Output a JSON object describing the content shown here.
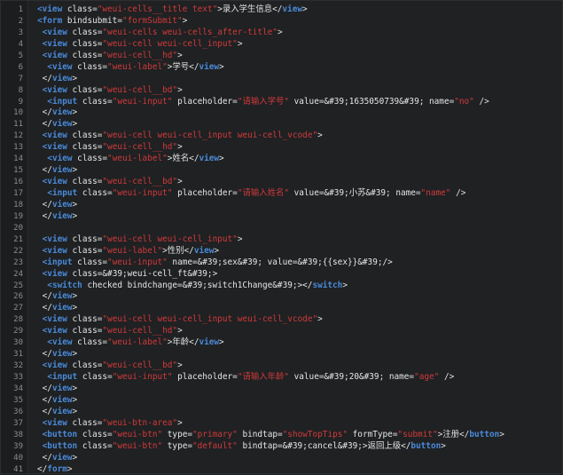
{
  "editor": {
    "lines": [
      {
        "n": "1",
        "t": [
          [
            "tag",
            "<view"
          ],
          [
            "attr",
            " class="
          ],
          [
            "str",
            "\"weui-cells__title text\""
          ],
          [
            "plain",
            ">录入学生信息</"
          ],
          [
            "tag",
            "view"
          ],
          [
            "plain",
            ">"
          ]
        ]
      },
      {
        "n": "2",
        "t": [
          [
            "tag",
            "<form"
          ],
          [
            "attr",
            " bindsubmit="
          ],
          [
            "str",
            "\"formSubmit\""
          ],
          [
            "plain",
            ">"
          ]
        ]
      },
      {
        "n": "3",
        "t": [
          [
            "plain",
            " "
          ],
          [
            "tag",
            "<view"
          ],
          [
            "attr",
            " class="
          ],
          [
            "str",
            "\"weui-cells weui-cells_after-title\""
          ],
          [
            "plain",
            ">"
          ]
        ]
      },
      {
        "n": "4",
        "t": [
          [
            "plain",
            " "
          ],
          [
            "tag",
            "<view"
          ],
          [
            "attr",
            " class="
          ],
          [
            "str",
            "\"weui-cell weui-cell_input\""
          ],
          [
            "plain",
            ">"
          ]
        ]
      },
      {
        "n": "5",
        "t": [
          [
            "plain",
            " "
          ],
          [
            "tag",
            "<view"
          ],
          [
            "attr",
            " class="
          ],
          [
            "str",
            "\"weui-cell__hd\""
          ],
          [
            "plain",
            ">"
          ]
        ]
      },
      {
        "n": "6",
        "t": [
          [
            "plain",
            "  "
          ],
          [
            "tag",
            "<view"
          ],
          [
            "attr",
            " class="
          ],
          [
            "str",
            "\"weui-label\""
          ],
          [
            "plain",
            ">学号</"
          ],
          [
            "tag",
            "view"
          ],
          [
            "plain",
            ">"
          ]
        ]
      },
      {
        "n": "7",
        "t": [
          [
            "plain",
            " </"
          ],
          [
            "tag",
            "view"
          ],
          [
            "plain",
            ">"
          ]
        ]
      },
      {
        "n": "8",
        "t": [
          [
            "plain",
            " "
          ],
          [
            "tag",
            "<view"
          ],
          [
            "attr",
            " class="
          ],
          [
            "str",
            "\"weui-cell__bd\""
          ],
          [
            "plain",
            ">"
          ]
        ]
      },
      {
        "n": "9",
        "t": [
          [
            "plain",
            "  "
          ],
          [
            "tag",
            "<input"
          ],
          [
            "attr",
            " class="
          ],
          [
            "str",
            "\"weui-input\""
          ],
          [
            "attr",
            " placeholder="
          ],
          [
            "str",
            "\"请输入学号\""
          ],
          [
            "attr",
            " value=&#39;1635050739&#39; name="
          ],
          [
            "str",
            "\"no\""
          ],
          [
            "plain",
            " />"
          ]
        ]
      },
      {
        "n": "10",
        "t": [
          [
            "plain",
            " </"
          ],
          [
            "tag",
            "view"
          ],
          [
            "plain",
            ">"
          ]
        ]
      },
      {
        "n": "11",
        "t": [
          [
            "plain",
            " </"
          ],
          [
            "tag",
            "view"
          ],
          [
            "plain",
            ">"
          ]
        ]
      },
      {
        "n": "12",
        "t": [
          [
            "plain",
            " "
          ],
          [
            "tag",
            "<view"
          ],
          [
            "attr",
            " class="
          ],
          [
            "str",
            "\"weui-cell weui-cell_input weui-cell_vcode\""
          ],
          [
            "plain",
            ">"
          ]
        ]
      },
      {
        "n": "13",
        "t": [
          [
            "plain",
            " "
          ],
          [
            "tag",
            "<view"
          ],
          [
            "attr",
            " class="
          ],
          [
            "str",
            "\"weui-cell__hd\""
          ],
          [
            "plain",
            ">"
          ]
        ]
      },
      {
        "n": "14",
        "t": [
          [
            "plain",
            "  "
          ],
          [
            "tag",
            "<view"
          ],
          [
            "attr",
            " class="
          ],
          [
            "str",
            "\"weui-label\""
          ],
          [
            "plain",
            ">姓名</"
          ],
          [
            "tag",
            "view"
          ],
          [
            "plain",
            ">"
          ]
        ]
      },
      {
        "n": "15",
        "t": [
          [
            "plain",
            " </"
          ],
          [
            "tag",
            "view"
          ],
          [
            "plain",
            ">"
          ]
        ]
      },
      {
        "n": "16",
        "t": [
          [
            "plain",
            " "
          ],
          [
            "tag",
            "<view"
          ],
          [
            "attr",
            " class="
          ],
          [
            "str",
            "\"weui-cell__bd\""
          ],
          [
            "plain",
            ">"
          ]
        ]
      },
      {
        "n": "17",
        "t": [
          [
            "plain",
            "  "
          ],
          [
            "tag",
            "<input"
          ],
          [
            "attr",
            " class="
          ],
          [
            "str",
            "\"weui-input\""
          ],
          [
            "attr",
            " placeholder="
          ],
          [
            "str",
            "\"请输入姓名\""
          ],
          [
            "attr",
            " value=&#39;小苏&#39; name="
          ],
          [
            "str",
            "\"name\""
          ],
          [
            "plain",
            " />"
          ]
        ]
      },
      {
        "n": "18",
        "t": [
          [
            "plain",
            " </"
          ],
          [
            "tag",
            "view"
          ],
          [
            "plain",
            ">"
          ]
        ]
      },
      {
        "n": "19",
        "t": [
          [
            "plain",
            " </"
          ],
          [
            "tag",
            "view"
          ],
          [
            "plain",
            ">"
          ]
        ]
      },
      {
        "n": "20",
        "t": []
      },
      {
        "n": "21",
        "t": [
          [
            "plain",
            " "
          ],
          [
            "tag",
            "<view"
          ],
          [
            "attr",
            " class="
          ],
          [
            "str",
            "\"weui-cell weui-cell_input\""
          ],
          [
            "plain",
            ">"
          ]
        ]
      },
      {
        "n": "22",
        "t": [
          [
            "plain",
            " "
          ],
          [
            "tag",
            "<view"
          ],
          [
            "attr",
            " class="
          ],
          [
            "str",
            "\"weui-label\""
          ],
          [
            "plain",
            ">性别</"
          ],
          [
            "tag",
            "view"
          ],
          [
            "plain",
            ">"
          ]
        ]
      },
      {
        "n": "23",
        "t": [
          [
            "plain",
            " "
          ],
          [
            "tag",
            "<input"
          ],
          [
            "attr",
            " class="
          ],
          [
            "str",
            "\"weui-input\""
          ],
          [
            "attr",
            " name=&#39;sex&#39; value=&#39;{{sex}}&#39;/>"
          ]
        ]
      },
      {
        "n": "24",
        "t": [
          [
            "plain",
            " "
          ],
          [
            "tag",
            "<view"
          ],
          [
            "attr",
            " class=&#39;weui-cell_ft&#39;>"
          ]
        ]
      },
      {
        "n": "25",
        "t": [
          [
            "plain",
            "  "
          ],
          [
            "tag",
            "<switch"
          ],
          [
            "attr",
            " checked bindchange=&#39;switch1Change&#39;></"
          ],
          [
            "tag",
            "switch"
          ],
          [
            "plain",
            ">"
          ]
        ]
      },
      {
        "n": "26",
        "t": [
          [
            "plain",
            " </"
          ],
          [
            "tag",
            "view"
          ],
          [
            "plain",
            ">"
          ]
        ]
      },
      {
        "n": "27",
        "t": [
          [
            "plain",
            " </"
          ],
          [
            "tag",
            "view"
          ],
          [
            "plain",
            ">"
          ]
        ]
      },
      {
        "n": "28",
        "t": [
          [
            "plain",
            " "
          ],
          [
            "tag",
            "<view"
          ],
          [
            "attr",
            " class="
          ],
          [
            "str",
            "\"weui-cell weui-cell_input weui-cell_vcode\""
          ],
          [
            "plain",
            ">"
          ]
        ]
      },
      {
        "n": "29",
        "t": [
          [
            "plain",
            " "
          ],
          [
            "tag",
            "<view"
          ],
          [
            "attr",
            " class="
          ],
          [
            "str",
            "\"weui-cell__hd\""
          ],
          [
            "plain",
            ">"
          ]
        ]
      },
      {
        "n": "30",
        "t": [
          [
            "plain",
            "  "
          ],
          [
            "tag",
            "<view"
          ],
          [
            "attr",
            " class="
          ],
          [
            "str",
            "\"weui-label\""
          ],
          [
            "plain",
            ">年龄</"
          ],
          [
            "tag",
            "view"
          ],
          [
            "plain",
            ">"
          ]
        ]
      },
      {
        "n": "31",
        "t": [
          [
            "plain",
            " </"
          ],
          [
            "tag",
            "view"
          ],
          [
            "plain",
            ">"
          ]
        ]
      },
      {
        "n": "32",
        "t": [
          [
            "plain",
            " "
          ],
          [
            "tag",
            "<view"
          ],
          [
            "attr",
            " class="
          ],
          [
            "str",
            "\"weui-cell__bd\""
          ],
          [
            "plain",
            ">"
          ]
        ]
      },
      {
        "n": "33",
        "t": [
          [
            "plain",
            "  "
          ],
          [
            "tag",
            "<input"
          ],
          [
            "attr",
            " class="
          ],
          [
            "str",
            "\"weui-input\""
          ],
          [
            "attr",
            " placeholder="
          ],
          [
            "str",
            "\"请输入年龄\""
          ],
          [
            "attr",
            " value=&#39;20&#39; name="
          ],
          [
            "str",
            "\"age\""
          ],
          [
            "plain",
            " />"
          ]
        ]
      },
      {
        "n": "34",
        "t": [
          [
            "plain",
            " </"
          ],
          [
            "tag",
            "view"
          ],
          [
            "plain",
            ">"
          ]
        ]
      },
      {
        "n": "35",
        "t": [
          [
            "plain",
            " </"
          ],
          [
            "tag",
            "view"
          ],
          [
            "plain",
            ">"
          ]
        ]
      },
      {
        "n": "36",
        "t": [
          [
            "plain",
            " </"
          ],
          [
            "tag",
            "view"
          ],
          [
            "plain",
            ">"
          ]
        ]
      },
      {
        "n": "37",
        "t": [
          [
            "plain",
            " "
          ],
          [
            "tag",
            "<view"
          ],
          [
            "attr",
            " class="
          ],
          [
            "str",
            "\"weui-btn-area\""
          ],
          [
            "plain",
            ">"
          ]
        ]
      },
      {
        "n": "38",
        "t": [
          [
            "plain",
            " "
          ],
          [
            "tag",
            "<button"
          ],
          [
            "attr",
            " class="
          ],
          [
            "str",
            "\"weui-btn\""
          ],
          [
            "attr",
            " type="
          ],
          [
            "str",
            "\"primary\""
          ],
          [
            "attr",
            " bindtap="
          ],
          [
            "str",
            "\"showTopTips\""
          ],
          [
            "attr",
            " formType="
          ],
          [
            "str",
            "\"submit\""
          ],
          [
            "plain",
            ">注册</"
          ],
          [
            "tag",
            "button"
          ],
          [
            "plain",
            ">"
          ]
        ]
      },
      {
        "n": "39",
        "t": [
          [
            "plain",
            " "
          ],
          [
            "tag",
            "<button"
          ],
          [
            "attr",
            " class="
          ],
          [
            "str",
            "\"weui-btn\""
          ],
          [
            "attr",
            " type="
          ],
          [
            "str",
            "\"default\""
          ],
          [
            "attr",
            " bindtap=&#39;cancel&#39;>返回上级</"
          ],
          [
            "tag",
            "button"
          ],
          [
            "plain",
            ">"
          ]
        ]
      },
      {
        "n": "40",
        "t": [
          [
            "plain",
            " </"
          ],
          [
            "tag",
            "view"
          ],
          [
            "plain",
            ">"
          ]
        ]
      },
      {
        "n": "41",
        "t": [
          [
            "plain",
            "</"
          ],
          [
            "tag",
            "form"
          ],
          [
            "plain",
            ">"
          ]
        ]
      }
    ]
  }
}
